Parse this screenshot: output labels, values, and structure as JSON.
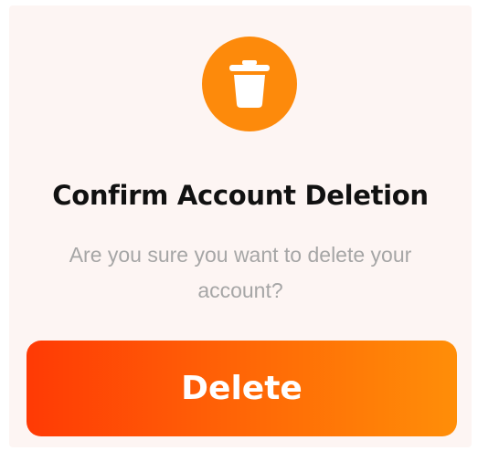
{
  "dialog": {
    "icon": "trash-icon",
    "title": "Confirm Account Deletion",
    "message": "Are you sure you want to delete your account?",
    "delete_label": "Delete"
  },
  "colors": {
    "icon_background": "#fd8a0b",
    "dialog_background": "#fdf5f3",
    "button_gradient_start": "#ff3a05",
    "button_gradient_end": "#ff8e08"
  }
}
